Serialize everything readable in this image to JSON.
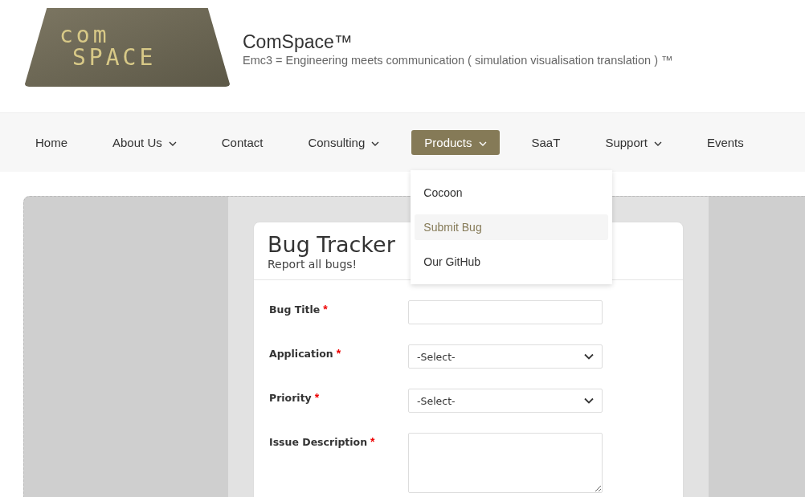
{
  "logo": {
    "line_1": "com",
    "line_2": "SPACE"
  },
  "site": {
    "title": "ComSpace™",
    "tagline": "Emc3 = Engineering meets communication ( simulation visualisation translation ) ™"
  },
  "nav": [
    {
      "label": "Home",
      "has_dropdown": false,
      "selected": false
    },
    {
      "label": "About Us",
      "has_dropdown": true,
      "selected": false
    },
    {
      "label": "Contact",
      "has_dropdown": false,
      "selected": false
    },
    {
      "label": "Consulting",
      "has_dropdown": true,
      "selected": false
    },
    {
      "label": "Products",
      "has_dropdown": true,
      "selected": true
    },
    {
      "label": "SaaT",
      "has_dropdown": false,
      "selected": false
    },
    {
      "label": "Support",
      "has_dropdown": true,
      "selected": false
    },
    {
      "label": "Events",
      "has_dropdown": false,
      "selected": false
    }
  ],
  "dropdown": [
    {
      "label": "Cocoon",
      "selected": false
    },
    {
      "label": "Submit Bug",
      "selected": true
    },
    {
      "label": "Our GitHub",
      "selected": false
    }
  ],
  "card": {
    "title": "Bug Tracker",
    "subtitle": "Report all bugs!"
  },
  "fields": [
    {
      "label": "Bug Title",
      "required_mark": "*",
      "kind": "text"
    },
    {
      "label": "Application",
      "required_mark": "*",
      "kind": "select",
      "value": "-Select-"
    },
    {
      "label": "Priority",
      "required_mark": "*",
      "kind": "select",
      "value": "-Select-"
    },
    {
      "label": "Issue Description",
      "required_mark": "*",
      "kind": "textarea"
    }
  ]
}
